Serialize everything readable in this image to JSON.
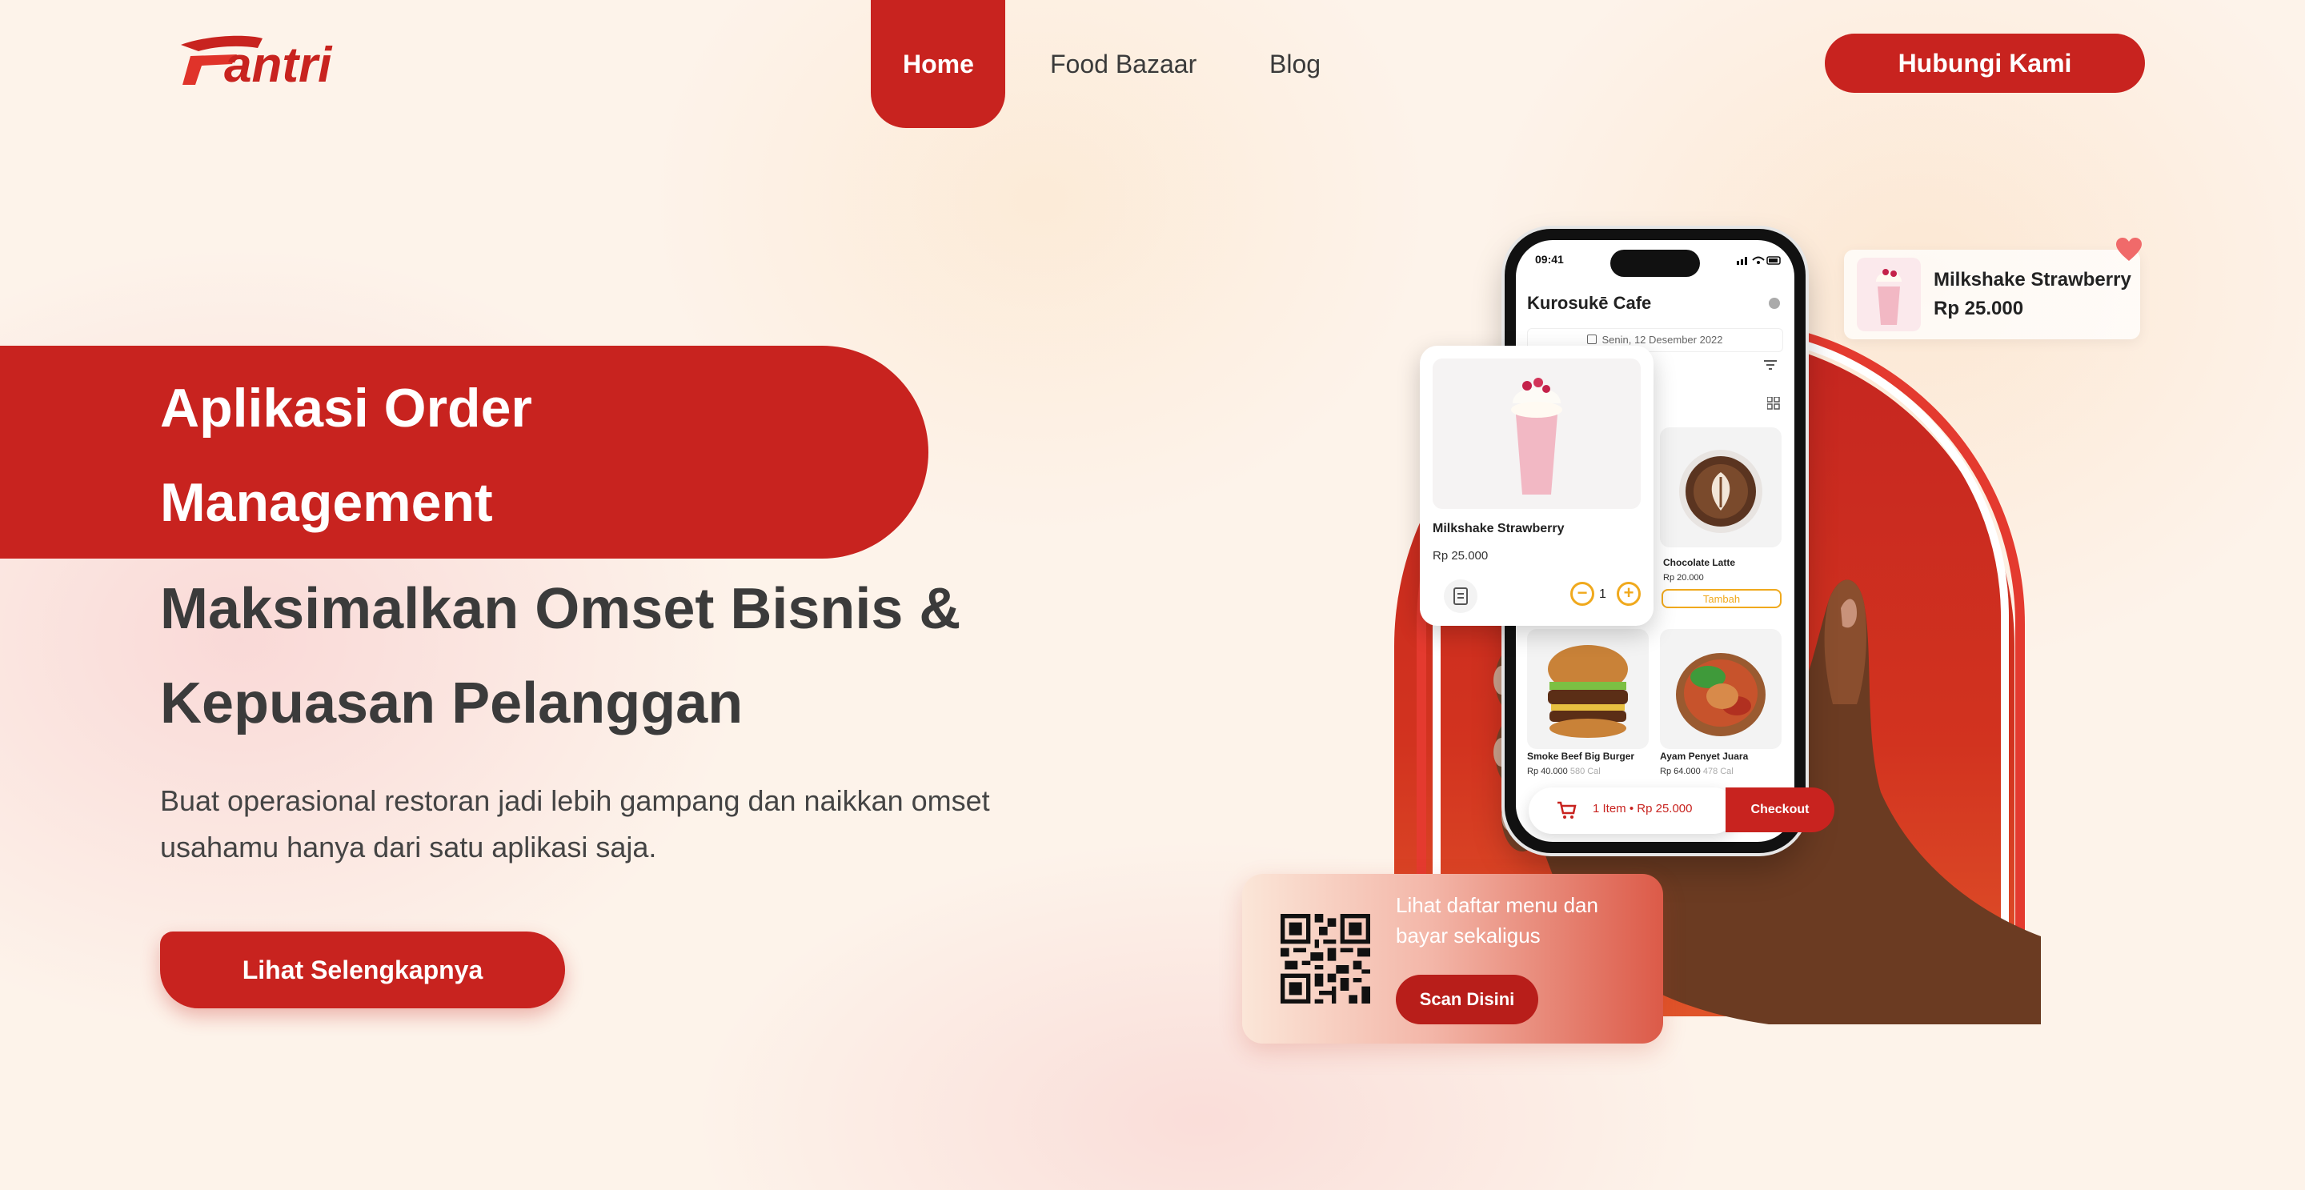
{
  "brand": {
    "logo_text": "Tantri",
    "accent": "#c8231f"
  },
  "nav": {
    "items": [
      {
        "label": "Home",
        "active": true
      },
      {
        "label": "Food Bazaar",
        "active": false
      },
      {
        "label": "Blog",
        "active": false
      }
    ],
    "contact_label": "Hubungi Kami"
  },
  "hero": {
    "title_line1": "Aplikasi Order",
    "title_line2": "Management",
    "subtitle_line1": "Maksimalkan Omset Bisnis &",
    "subtitle_line2": "Kepuasan Pelanggan",
    "description": "Buat operasional restoran jadi lebih gampang dan naikkan omset usahamu hanya dari satu aplikasi saja.",
    "cta_label": "Lihat Selengkapnya"
  },
  "phone": {
    "time": "09:41",
    "cafe_name": "Kurosukē Cafe",
    "date": "Senin, 12 Desember 2022",
    "items": [
      {
        "name": "Chocolate Latte",
        "price": "Rp 20.000",
        "action": "Tambah"
      },
      {
        "name": "Smoke Beef Big Burger",
        "price": "Rp 40.000",
        "cal": "580 Cal"
      },
      {
        "name": "Ayam Penyet Juara",
        "price": "Rp 64.000",
        "cal": "478 Cal"
      }
    ],
    "cart_summary": "1 Item • Rp 25.000",
    "checkout_label": "Checkout"
  },
  "product_card": {
    "name": "Milkshake Strawberry",
    "price": "Rp 25.000",
    "qty": "1"
  },
  "favorite_card": {
    "name": "Milkshake Strawberry",
    "price": "Rp 25.000"
  },
  "qr_card": {
    "text": "Lihat daftar menu dan bayar sekaligus",
    "button_label": "Scan Disini"
  }
}
